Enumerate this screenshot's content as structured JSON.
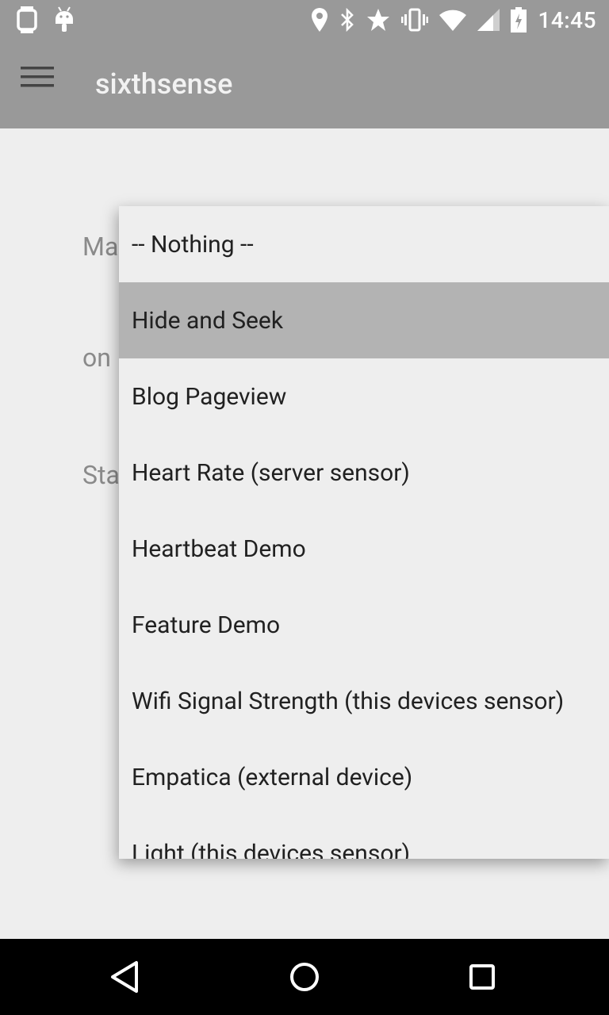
{
  "status_bar": {
    "time": "14:45",
    "icons_left": [
      "watch-icon",
      "android-icon"
    ],
    "icons_right": [
      "location-icon",
      "bluetooth-icon",
      "star-icon",
      "vibrate-icon",
      "wifi-icon",
      "cell-signal-icon",
      "battery-icon"
    ]
  },
  "app_bar": {
    "title": "sixthsense",
    "menu_icon": "hamburger-menu-icon"
  },
  "background_labels": [
    "Ma",
    "on",
    "Sta"
  ],
  "dropdown": {
    "selected_index": 1,
    "items": [
      "-- Nothing --",
      "Hide and Seek",
      "Blog Pageview",
      "Heart Rate (server sensor)",
      "Heartbeat Demo",
      "Feature Demo",
      "Wifi Signal Strength (this devices sensor)",
      "Empatica (external device)",
      "Light (this devices sensor)"
    ]
  },
  "nav_bar": {
    "back_icon": "back-triangle-icon",
    "home_icon": "home-circle-icon",
    "recents_icon": "recents-square-icon"
  },
  "colors": {
    "app_bar": "#999999",
    "background": "#eeeeee",
    "selected_item": "#b3b3b3",
    "text": "#212121"
  }
}
